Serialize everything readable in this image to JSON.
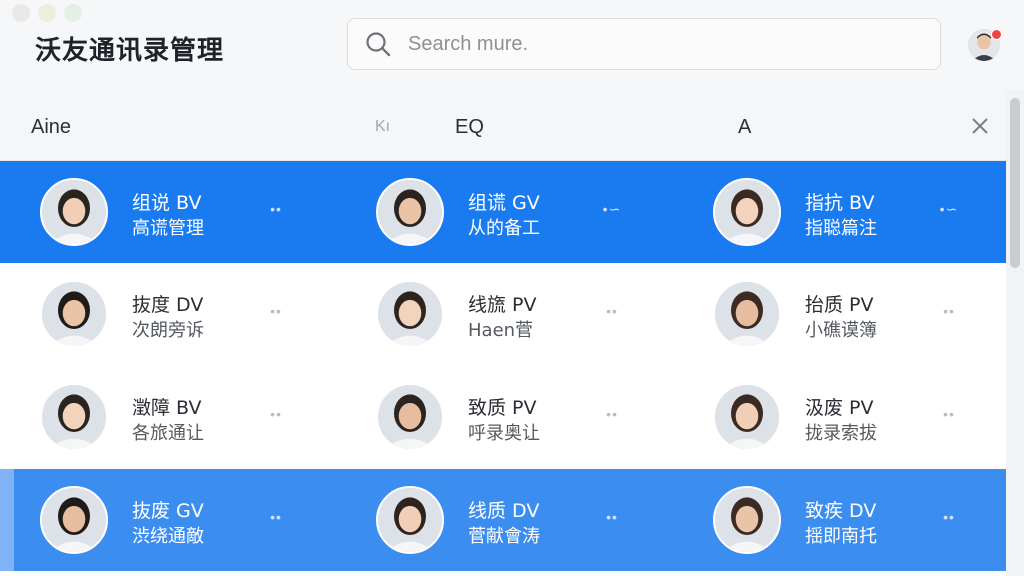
{
  "app": {
    "title": "沃友通讯录管理"
  },
  "search": {
    "placeholder": "Search mure."
  },
  "header": {
    "col1": "Aine",
    "sort_glyph": "Kı",
    "col2": "EQ",
    "col3": "A"
  },
  "rows": [
    {
      "selected": true,
      "cells": [
        {
          "name": "组说 BV",
          "note": "高谎管理",
          "more": "••"
        },
        {
          "name": "组谎 GV",
          "note": "从的备工",
          "more": "•∽"
        },
        {
          "name": "指抗 BV",
          "note": "指聪篇注",
          "more": "•∽"
        }
      ]
    },
    {
      "selected": false,
      "cells": [
        {
          "name": "抜度 DV",
          "note": "次朗旁诉",
          "more": "••"
        },
        {
          "name": "线旒 PV",
          "note": "Haen菅",
          "more": "••"
        },
        {
          "name": "抬质 PV",
          "note": "小礁谟簿",
          "more": "••"
        }
      ]
    },
    {
      "selected": false,
      "cells": [
        {
          "name": "澂障 BV",
          "note": "各旅通让",
          "more": "••"
        },
        {
          "name": "致质 PV",
          "note": "呼录奥让",
          "more": "••"
        },
        {
          "name": "汲废 PV",
          "note": "拢录索拔",
          "more": "••"
        }
      ]
    },
    {
      "selected": true,
      "cells": [
        {
          "name": "抜废 GV",
          "note": "渋绕通敵",
          "more": "••"
        },
        {
          "name": "线质 DV",
          "note": "菅献會涛",
          "more": "••"
        },
        {
          "name": "致疾 DV",
          "note": "揺即南托",
          "more": "••"
        }
      ]
    }
  ],
  "colors": {
    "selected_row": "#1a7bf0",
    "selected_row_alt": "#3b8ef0",
    "notification": "#f04545"
  },
  "icons": [
    "search-icon",
    "close-icon",
    "more-icon",
    "avatar"
  ]
}
